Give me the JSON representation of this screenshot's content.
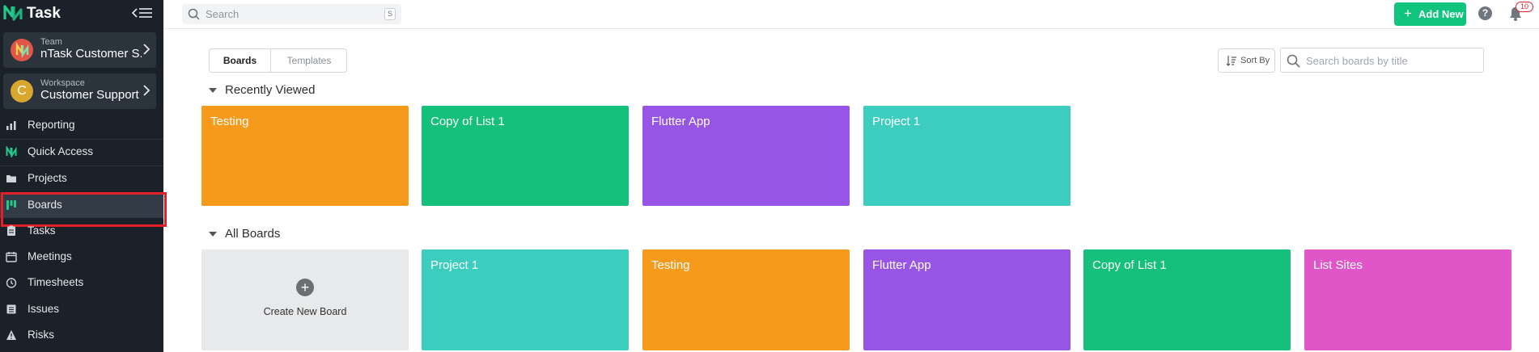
{
  "brand": {
    "name": "Task"
  },
  "team": {
    "label": "Team",
    "name": "nTask Customer S...",
    "initial": "N",
    "color": "#e0574a"
  },
  "workspace": {
    "label": "Workspace",
    "name": "Customer Support",
    "initial": "C",
    "color": "#e0b13a"
  },
  "nav": [
    {
      "label": "Reporting",
      "icon": "reporting-icon"
    },
    {
      "label": "Quick Access",
      "icon": "quick-access-icon"
    },
    {
      "label": "Projects",
      "icon": "projects-icon"
    },
    {
      "label": "Boards",
      "icon": "boards-icon",
      "active": true
    },
    {
      "label": "Tasks",
      "icon": "tasks-icon"
    },
    {
      "label": "Meetings",
      "icon": "meetings-icon"
    },
    {
      "label": "Timesheets",
      "icon": "timesheets-icon"
    },
    {
      "label": "Issues",
      "icon": "issues-icon"
    },
    {
      "label": "Risks",
      "icon": "risks-icon"
    }
  ],
  "topbar": {
    "search_placeholder": "Search",
    "search_shortcut": "S",
    "add_new_label": "Add New",
    "help_label": "?",
    "notification_count": "10"
  },
  "toolbar": {
    "tabs": [
      "Boards",
      "Templates"
    ],
    "sort_label": "Sort By",
    "board_search_placeholder": "Search boards by title"
  },
  "recent": {
    "title": "Recently Viewed",
    "boards": [
      {
        "name": "Testing",
        "color": "#f59a1b"
      },
      {
        "name": "Copy of List 1",
        "color": "#15c07a"
      },
      {
        "name": "Flutter App",
        "color": "#9655e4"
      },
      {
        "name": "Project 1",
        "color": "#3ccdbe"
      }
    ]
  },
  "all": {
    "title": "All Boards",
    "create_label": "Create New Board",
    "boards": [
      {
        "name": "Project 1",
        "color": "#3ccdbe"
      },
      {
        "name": "Testing",
        "color": "#f59a1b"
      },
      {
        "name": "Flutter App",
        "color": "#9655e4"
      },
      {
        "name": "Copy of List 1",
        "color": "#15c07a"
      },
      {
        "name": "List Sites",
        "color": "#e055c8"
      }
    ]
  }
}
